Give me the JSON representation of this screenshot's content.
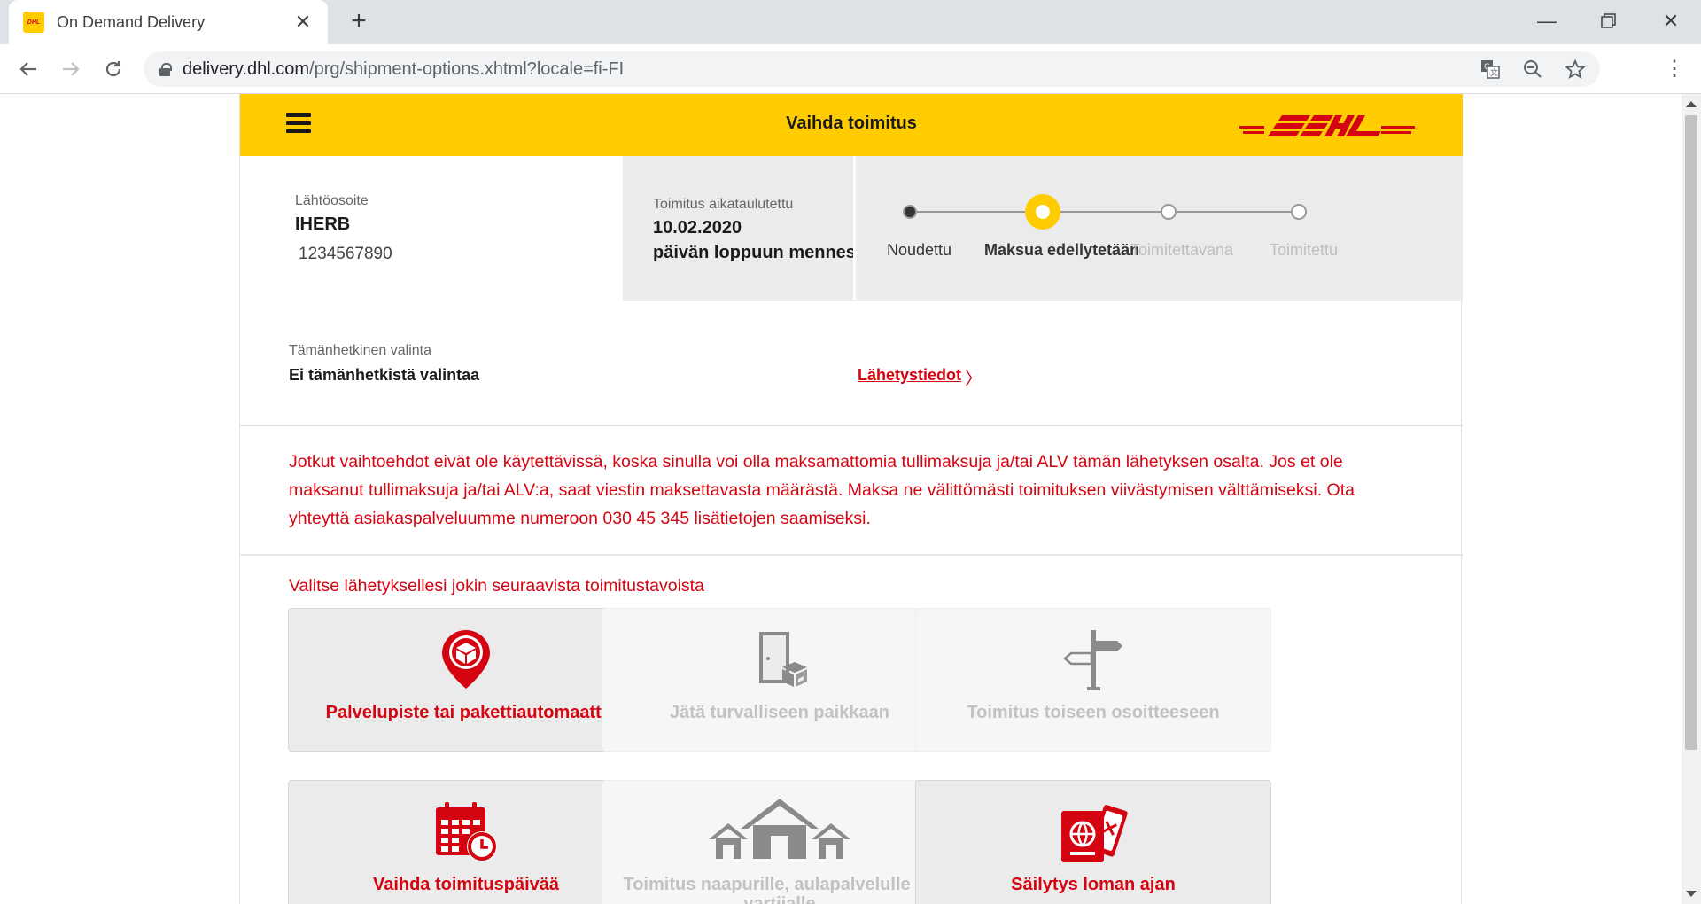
{
  "browser": {
    "tab_title": "On Demand Delivery",
    "favicon_text": "DHL",
    "url_domain": "delivery.dhl.com",
    "url_path": "/prg/shipment-options.xhtml?locale=fi-FI",
    "icons": [
      "back-icon",
      "forward-icon",
      "reload-icon",
      "lock-icon",
      "translate-icon",
      "zoom-out-icon",
      "star-icon",
      "menu-dots-icon",
      "minimize-icon",
      "restore-icon",
      "close-icon"
    ]
  },
  "header": {
    "title": "Vaihda toimitus",
    "logo_text": "DHL",
    "brand_yellow": "#ffcc00",
    "brand_red": "#d40511"
  },
  "sender": {
    "label": "Lähtöosoite",
    "name": "IHERB",
    "number": "1234567890"
  },
  "schedule": {
    "label": "Toimitus aikataulutettu",
    "date": "10.02.2020",
    "time": "päivän loppuun mennessä"
  },
  "progress": {
    "steps": [
      {
        "label": "Noudettu",
        "state": "done"
      },
      {
        "label": "Maksua edellytetään",
        "state": "current"
      },
      {
        "label": "Toimitettavana",
        "state": "future"
      },
      {
        "label": "Toimitettu",
        "state": "future"
      }
    ]
  },
  "selection": {
    "label": "Tämänhetkinen valinta",
    "value": "Ei tämänhetkistä valintaa",
    "link": "Lähetystiedot"
  },
  "warning": {
    "text": "Jotkut vaihtoehdot eivät ole käytettävissä, koska sinulla voi olla maksamattomia tullimaksuja ja/tai ALV tämän lähetyksen osalta. Jos et ole maksanut tullimaksuja ja/tai ALV:a, saat viestin maksettavasta määrästä. Maksa ne välittömästi toimituksen viivästymisen välttämiseksi. Ota yhteyttä asiakaspalveluumme numeroon 030 45 345 lisätietojen saamiseksi."
  },
  "options": {
    "title": "Valitse lähetyksellesi jokin seuraavista toimitustavoista",
    "items": [
      {
        "label": "Palvelupiste tai pakettiautomaatti",
        "icon": "location-pin-package-icon",
        "enabled": true
      },
      {
        "label": "Jätä turvalliseen paikkaan",
        "icon": "door-package-icon",
        "enabled": false
      },
      {
        "label": "Toimitus toiseen osoitteeseen",
        "icon": "signpost-icon",
        "enabled": false
      },
      {
        "label": "Vaihda toimituspäivää",
        "icon": "calendar-clock-icon",
        "enabled": true
      },
      {
        "label": "Toimitus naapurille, aulapalvelulle tai vartijalle",
        "icon": "houses-icon",
        "enabled": false
      },
      {
        "label": "Säilytys loman ajan",
        "icon": "passport-ticket-icon",
        "enabled": true
      }
    ]
  }
}
